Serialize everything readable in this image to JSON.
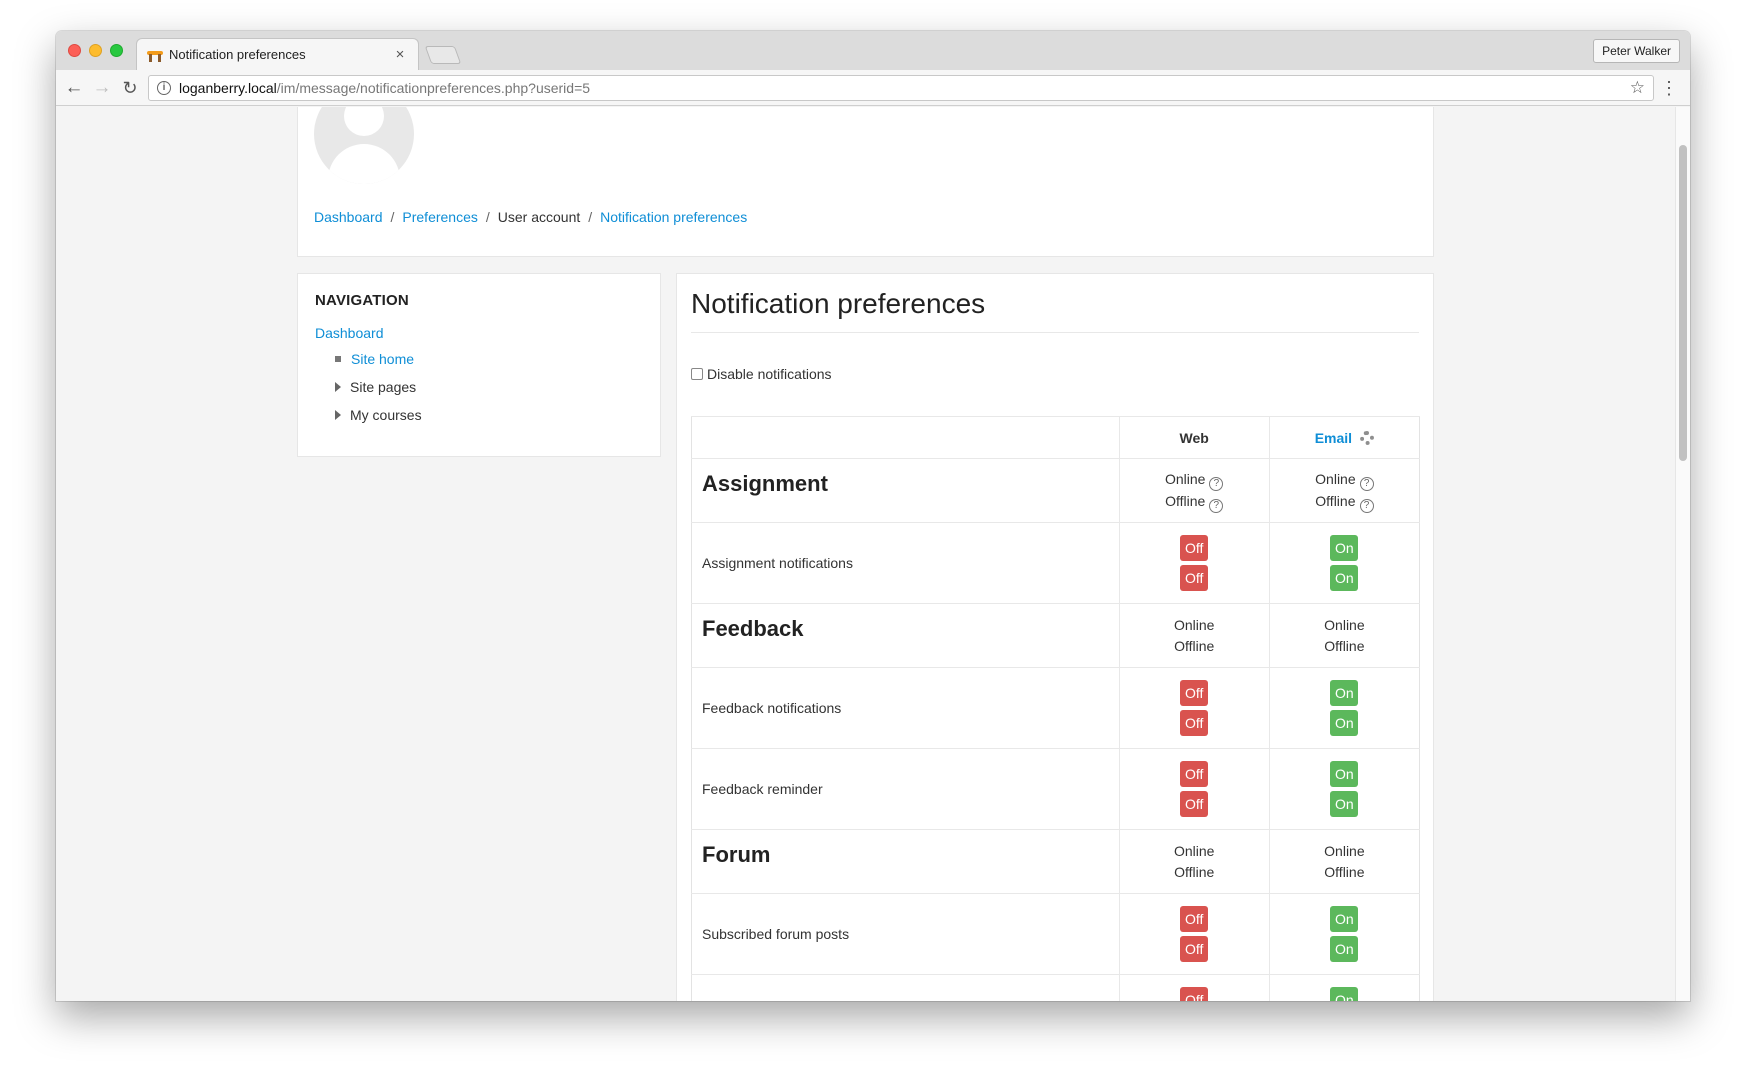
{
  "browser": {
    "tab_title": "Notification preferences",
    "tab_close": "×",
    "profile": "Peter Walker",
    "url_host": "loganberry.local",
    "url_path": "/im/message/notificationpreferences.php?userid=5"
  },
  "header": {
    "user_name": "Peter Walker",
    "breadcrumb": [
      "Dashboard",
      "Preferences",
      "User account",
      "Notification preferences"
    ],
    "sep": "/"
  },
  "navigation": {
    "title": "NAVIGATION",
    "dashboard": "Dashboard",
    "items": [
      "Site home",
      "Site pages",
      "My courses"
    ]
  },
  "main": {
    "title": "Notification preferences",
    "disable_label": "Disable notifications",
    "col_web": "Web",
    "col_email": "Email",
    "online": "Online",
    "offline": "Offline",
    "off": "Off",
    "on": "On",
    "components": [
      {
        "name": "Assignment",
        "items": [
          "Assignment notifications"
        ]
      },
      {
        "name": "Feedback",
        "items": [
          "Feedback notifications",
          "Feedback reminder"
        ]
      },
      {
        "name": "Forum",
        "items": [
          "Subscribed forum posts"
        ]
      }
    ]
  }
}
